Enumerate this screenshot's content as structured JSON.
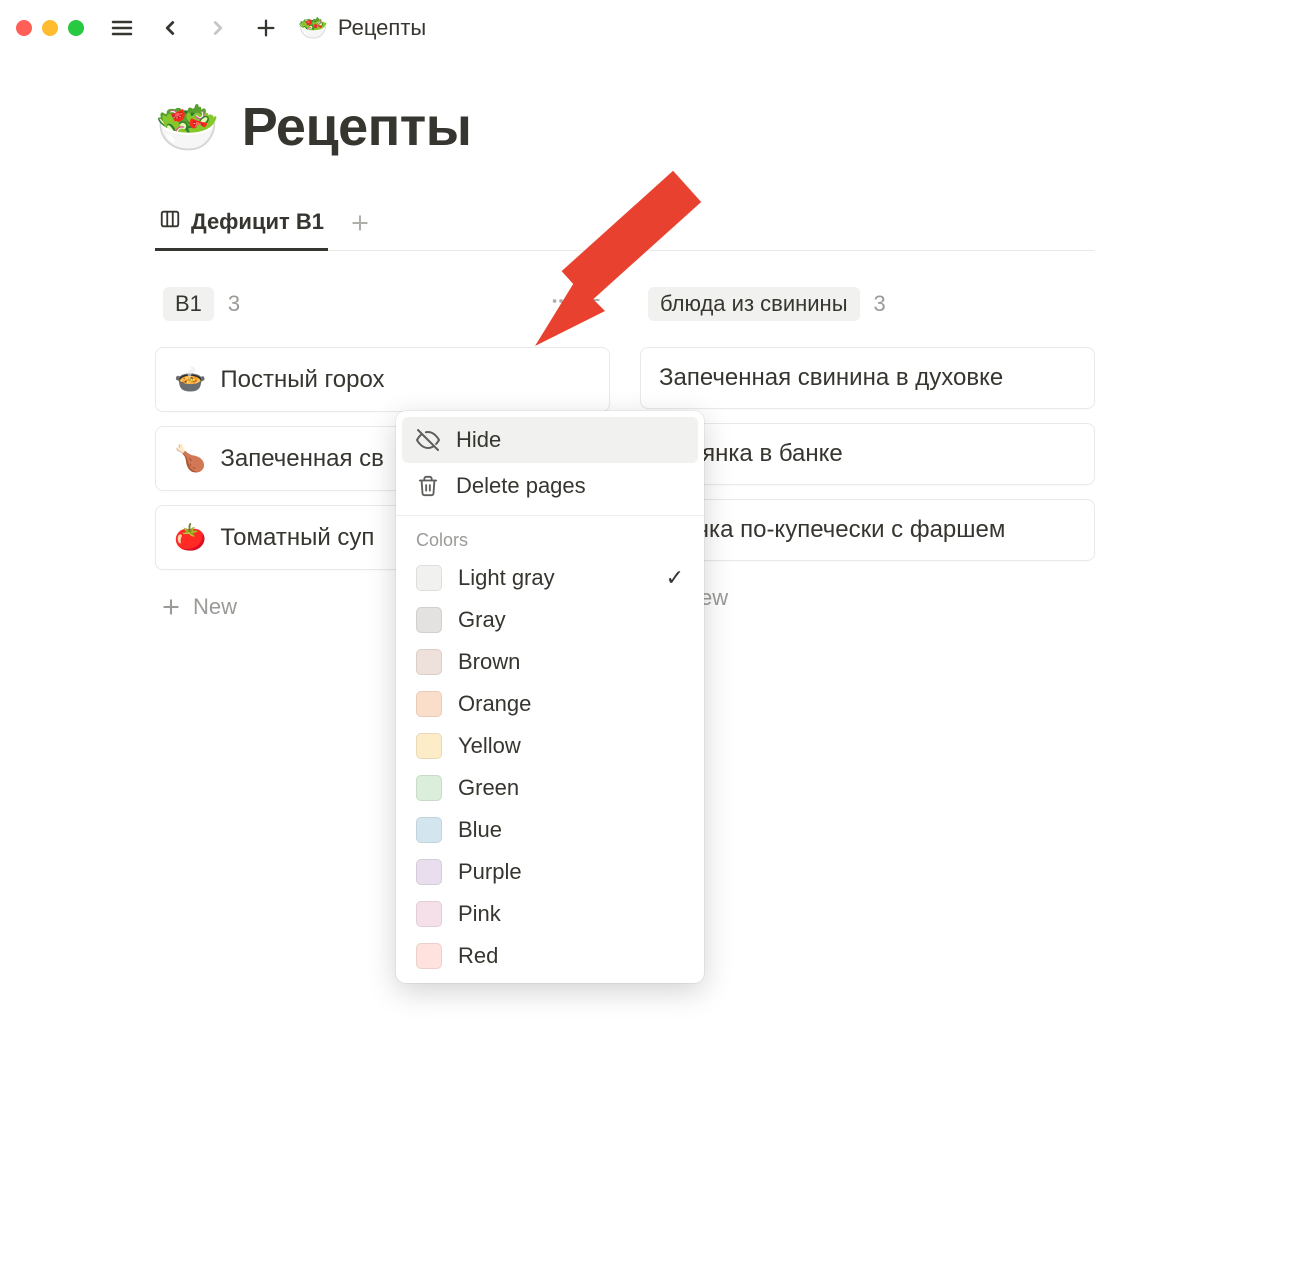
{
  "topbar": {
    "breadcrumb_title": "Рецепты"
  },
  "page": {
    "icon": "🥗",
    "title": "Рецепты"
  },
  "tabs": {
    "active_label": "Дефицит В1"
  },
  "board": {
    "columns": [
      {
        "tag": "В1",
        "count": "3",
        "cards": [
          {
            "emoji": "🍲",
            "title": "Постный горох"
          },
          {
            "emoji": "🍗",
            "title": "Запеченная св"
          },
          {
            "emoji": "🍅",
            "title": "Томатный суп"
          }
        ],
        "new_label": "New"
      },
      {
        "tag": "блюда из свинины",
        "count": "3",
        "cards": [
          {
            "title": "Запеченная свинина в духовке"
          },
          {
            "title": "Овсянка в банке"
          },
          {
            "title": "Гречка по-купечески с фаршем"
          }
        ],
        "new_label": "ew"
      }
    ]
  },
  "menu": {
    "hide": "Hide",
    "delete": "Delete pages",
    "colors_label": "Colors",
    "colors": [
      {
        "name": "Light gray",
        "hex": "#f1f1ef",
        "selected": true
      },
      {
        "name": "Gray",
        "hex": "#e3e2e0",
        "selected": false
      },
      {
        "name": "Brown",
        "hex": "#eee0da",
        "selected": false
      },
      {
        "name": "Orange",
        "hex": "#fadec9",
        "selected": false
      },
      {
        "name": "Yellow",
        "hex": "#fdecc8",
        "selected": false
      },
      {
        "name": "Green",
        "hex": "#dbeddb",
        "selected": false
      },
      {
        "name": "Blue",
        "hex": "#d3e5ef",
        "selected": false
      },
      {
        "name": "Purple",
        "hex": "#e8deee",
        "selected": false
      },
      {
        "name": "Pink",
        "hex": "#f5e0e9",
        "selected": false
      },
      {
        "name": "Red",
        "hex": "#ffe2dd",
        "selected": false
      }
    ]
  },
  "arrow_color": "#e8412f"
}
